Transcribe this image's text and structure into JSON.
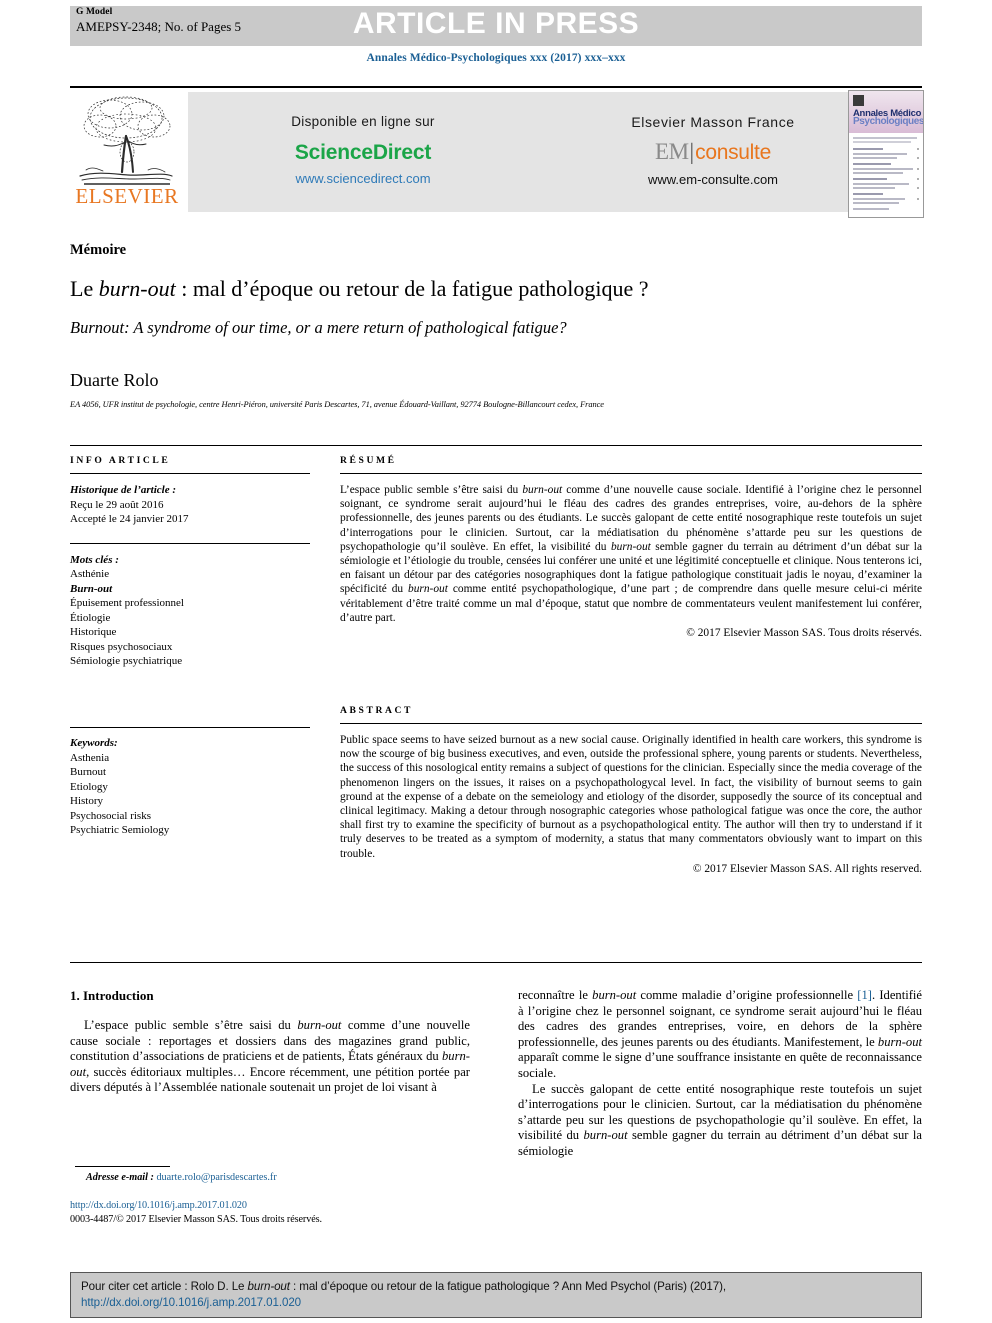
{
  "header": {
    "g_model": "G Model",
    "article_id": "AMEPSY-2348; No. of Pages 5",
    "banner": "ARTICLE IN PRESS",
    "journal_line": "Annales Médico-Psychologiques xxx (2017) xxx–xxx"
  },
  "masthead": {
    "elsevier_wordmark": "ELSEVIER",
    "sciencedirect": {
      "available_on": "Disponible en ligne sur",
      "name": "ScienceDirect",
      "url": "www.sciencedirect.com"
    },
    "em_consulte": {
      "publisher": "Elsevier Masson France",
      "logo_em": "EM",
      "logo_consulte": "consulte",
      "url": "www.em-consulte.com"
    },
    "cover": {
      "title_line1": "Annales Médico",
      "title_line2": "Psychologiques"
    }
  },
  "article": {
    "section_type": "Mémoire",
    "title_fr_pre": "Le ",
    "title_fr_italic": "burn-out",
    "title_fr_post": " : mal d’époque ou retour de la fatigue pathologique ?",
    "title_en": "Burnout: A syndrome of our time, or a mere return of pathological fatigue?",
    "author": "Duarte Rolo",
    "affiliation": "EA 4056, UFR institut de psychologie, centre Henri-Piéron, université Paris Descartes, 71, avenue Édouard-Vaillant, 92774 Boulogne-Billancourt cedex, France"
  },
  "info_article": {
    "heading": "INFO ARTICLE",
    "history_label": "Historique de l’article :",
    "received": "Reçu le 29 août 2016",
    "accepted": "Accepté le 24 janvier 2017",
    "keywords_label": "Mots clés :",
    "keywords": [
      "Asthénie",
      "Burn-out",
      "Épuisement professionnel",
      "Étiologie",
      "Historique",
      "Risques psychosociaux",
      "Sémiologie psychiatrique"
    ],
    "keywords_en_label": "Keywords:",
    "keywords_en": [
      "Asthenia",
      "Burnout",
      "Etiology",
      "History",
      "Psychosocial risks",
      "Psychiatric Semiology"
    ]
  },
  "resume": {
    "heading": "RÉSUMÉ",
    "p1": "L’espace public semble s’être saisi du ",
    "p1_it": "burn-out",
    "p2": " comme d’une nouvelle cause sociale. Identifié à l’origine chez le personnel soignant, ce syndrome serait aujourd’hui le fléau des cadres des grandes entreprises, voire, au-dehors de la sphère professionnelle, des jeunes parents ou des étudiants. Le succès galopant de cette entité nosographique reste toutefois un sujet d’interrogations pour le clinicien. Surtout, car la médiatisation du phénomène s’attarde peu sur les questions de psychopathologie qu’il soulève. En effet, la visibilité du ",
    "p3_it": "burn-out",
    "p4": " semble gagner du terrain au détriment d’un débat sur la sémiologie et l’étiologie du trouble, censées lui conférer une unité et une légitimité conceptuelle et clinique. Nous tenterons ici, en faisant un détour par des catégories nosographiques dont la fatigue pathologique constituait jadis le noyau, d’examiner la spécificité du ",
    "p5_it": "burn-out",
    "p6": " comme entité psychopathologique, d’une part ; de comprendre dans quelle mesure celui-ci mérite véritablement d’être traité comme un mal d’époque, statut que nombre de commentateurs veulent manifestement lui conférer, d’autre part.",
    "copyright": "© 2017 Elsevier Masson SAS. Tous droits réservés."
  },
  "abstract": {
    "heading": "ABSTRACT",
    "text": "Public space seems to have seized burnout as a new social cause. Originally identified in health care workers, this syndrome is now the scourge of big business executives, and even, outside the professional sphere, young parents or students. Nevertheless, the success of this nosological entity remains a subject of questions for the clinician. Especially since the media coverage of the phenomenon lingers on the issues, it raises on a psychopathologycal level. In fact, the visibility of burnout seems to gain ground at the expense of a debate on the semeiology and etiology of the disorder, supposedly the source of its conceptual and clinical legitimacy. Making a detour through nosographic categories whose pathological fatigue was once the core, the author shall first try to examine the specificity of burnout as a psychopathological entity. The author will then try to understand if it truly deserves to be treated as a symptom of modernity, a status that many commentators obviously want to impart on this trouble.",
    "copyright": "© 2017 Elsevier Masson SAS. All rights reserved."
  },
  "body": {
    "section_heading": "1. Introduction",
    "left_p1_a": "L’espace public semble s’être saisi du ",
    "left_p1_it": "burn-out",
    "left_p1_b": " comme d’une nouvelle cause sociale : reportages et dossiers dans des magazines grand public, constitution d’associations de praticiens et de patients, États généraux du ",
    "left_p1_it2": "burn-out",
    "left_p1_c": ", succès éditoriaux multiples… Encore récemment, une pétition portée par divers députés à l’Assemblée nationale soutenait un projet de loi visant à",
    "right_p1_a": "reconnaître le ",
    "right_p1_it": "burn-out",
    "right_p1_b": " comme maladie d’origine professionnelle ",
    "right_p1_ref": "[1]",
    "right_p1_c": ". Identifié à l’origine chez le personnel soignant, ce syndrome serait aujourd’hui le fléau des cadres des grandes entreprises, voire, en dehors de la sphère professionnelle, des jeunes parents ou des étudiants. Manifestement, le ",
    "right_p1_it2": "burn-out",
    "right_p1_d": " apparaît comme le signe d’une souffrance insistante en quête de reconnaissance sociale.",
    "right_p2_a": "Le succès galopant de cette entité nosographique reste toutefois un sujet d’interrogations pour le clinicien. Surtout, car la médiatisation du phénomène s’attarde peu sur les questions de psychopathologie qu’il soulève. En effet, la visibilité du ",
    "right_p2_it": "burn-out",
    "right_p2_b": " semble gagner du terrain au détriment d’un débat sur la sémiologie"
  },
  "footer": {
    "email_label": "Adresse e-mail :",
    "email": "duarte.rolo@parisdescartes.fr",
    "doi": "http://dx.doi.org/10.1016/j.amp.2017.01.020",
    "issn": "0003-4487/© 2017 Elsevier Masson SAS. Tous droits réservés."
  },
  "citation": {
    "prefix": "Pour citer cet article : Rolo D. Le ",
    "italic": "burn-out",
    "middle": " : mal d’époque ou retour de la fatigue pathologique ? Ann Med Psychol (Paris) (2017), ",
    "link": "http://dx.doi.org/10.1016/j.amp.2017.01.020"
  },
  "colors": {
    "journal_blue": "#1a5f94",
    "sciencedirect_green": "#1BA548",
    "elsevier_orange": "#E87722",
    "banner_gray": "#c9c9c9"
  }
}
